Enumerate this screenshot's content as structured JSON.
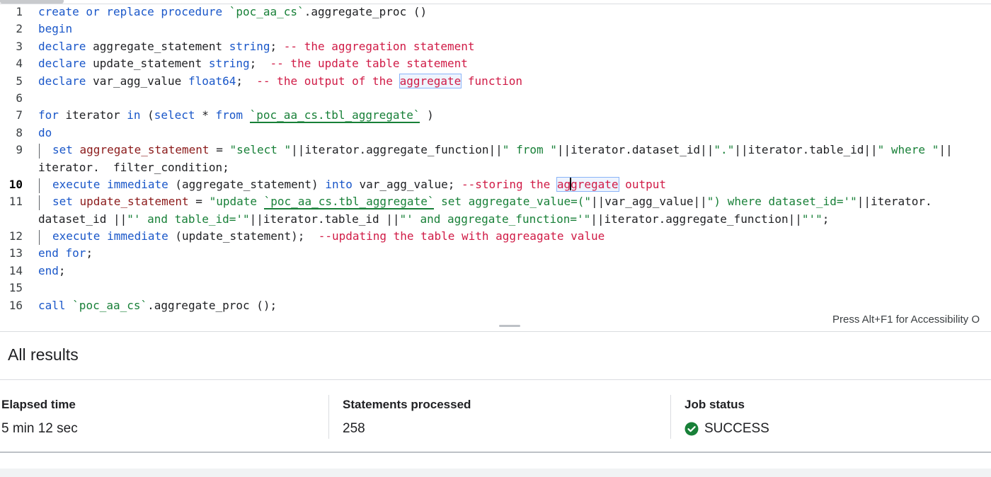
{
  "editor": {
    "line_numbers": [
      "1",
      "2",
      "3",
      "4",
      "5",
      "6",
      "7",
      "8",
      "9",
      "",
      "10",
      "11",
      "",
      "12",
      "13",
      "14",
      "15",
      "16"
    ],
    "tokens": {
      "l1_kw": "create or replace procedure",
      "l1_str": "`poc_aa_cs`",
      "l1_rest": ".aggregate_proc ()",
      "l2_kw": "begin",
      "l3_kw": "declare",
      "l3_name": " aggregate_statement ",
      "l3_type": "string",
      "l3_semi": "; ",
      "l3_cm": "-- the aggregation statement",
      "l4_kw": "declare",
      "l4_name": " update_statement ",
      "l4_type": "string",
      "l4_semi": ";  ",
      "l4_cm": "-- the update table statement",
      "l5_kw": "declare",
      "l5_name": " var_agg_value ",
      "l5_type": "float64",
      "l5_semi": ";  ",
      "l5_cm1": "-- the output of the ",
      "l5_cm_hl": "aggregate",
      "l5_cm2": " function",
      "l7_kw1": "for",
      "l7_t1": " iterator ",
      "l7_kw2": "in",
      "l7_t2": " (",
      "l7_kw3": "select",
      "l7_t3": " * ",
      "l7_kw4": "from",
      "l7_t4": " ",
      "l7_bt": "`poc_aa_cs.tbl_aggregate`",
      "l7_t5": " )",
      "l8_kw": "do",
      "l9_kw": "set",
      "l9_var": " aggregate_statement",
      "l9_t1": " = ",
      "l9_s1": "\"select \"",
      "l9_t2": "||iterator.aggregate_function||",
      "l9_s2": "\" from \"",
      "l9_t3": "||iterator.dataset_id||",
      "l9_s3": "\".\"",
      "l9_t4": "||iterator.table_id||",
      "l9_s4": "\" where \"",
      "l9_t5": "||",
      "l9b_t": "iterator.  filter_condition;",
      "l10_kw1": "execute immediate",
      "l10_t1": " (aggregate_statement) ",
      "l10_kw2": "into",
      "l10_t2": " var_agg_value; ",
      "l10_cm1": "--storing the ",
      "l10_hl_a": "ag",
      "l10_hl_b": "gregate",
      "l10_cm2": " output",
      "l11_kw": "set",
      "l11_var": " update_statement",
      "l11_t1": " = ",
      "l11_s1": "\"update ",
      "l11_bt": "`poc_aa_cs.tbl_aggregate`",
      "l11_s2": " set aggregate_value=(\"",
      "l11_t2": "||var_agg_value||",
      "l11_s3": "\") where dataset_id='\"",
      "l11_t3": "||iterator.",
      "l11b_t1": "dataset_id ||",
      "l11b_s1": "\"' and table_id='\"",
      "l11b_t2": "||iterator.table_id ||",
      "l11b_s2": "\"' and aggregate_function='\"",
      "l11b_t3": "||iterator.aggregate_function||",
      "l11b_s3": "\"'\"",
      "l11b_t4": ";",
      "l12_kw": "execute immediate",
      "l12_t1": " (update_statement);  ",
      "l12_cm": "--updating the table with aggreagate value",
      "l13_kw": "end for",
      "l13_t": ";",
      "l14_kw": "end",
      "l14_t": ";",
      "l16_kw": "call",
      "l16_t1": " ",
      "l16_str": "`poc_aa_cs`",
      "l16_t2": ".aggregate_proc ();"
    },
    "accessibility_hint": "Press Alt+F1 for Accessibility O"
  },
  "results": {
    "title": "All results",
    "stats": [
      {
        "label": "Elapsed time",
        "value": "5 min 12 sec"
      },
      {
        "label": "Statements processed",
        "value": "258"
      },
      {
        "label": "Job status",
        "value": "SUCCESS"
      }
    ],
    "status_color": "#188038"
  },
  "colors": {
    "keyword": "#1a57c9",
    "string": "#188038",
    "comment": "#d01b46",
    "variable": "#8b1a1a"
  }
}
